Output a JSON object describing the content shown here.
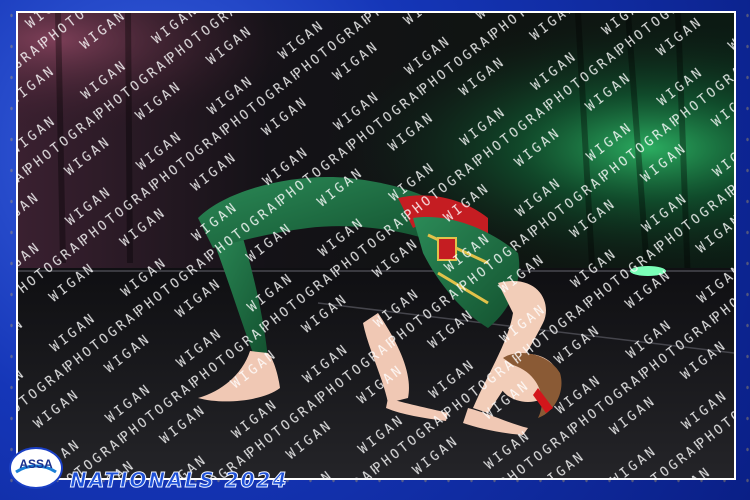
{
  "event": {
    "title": "NATIONALS 2024",
    "org_logo_text": "ASSA"
  },
  "watermark": {
    "text": "WIGAN PHOTOGRAPHY"
  },
  "colors": {
    "frame_blue": "#1536b8",
    "frame_gold_speckle": "#d4b35a",
    "stage_floor": "#1a1a1d",
    "curtain_green_light": "#2fbf6a",
    "leotard_green": "#1f6b43",
    "leotard_red": "#c51d22",
    "leotard_gold_trim": "#e2c24a",
    "hair_bow_red": "#d3161b"
  }
}
